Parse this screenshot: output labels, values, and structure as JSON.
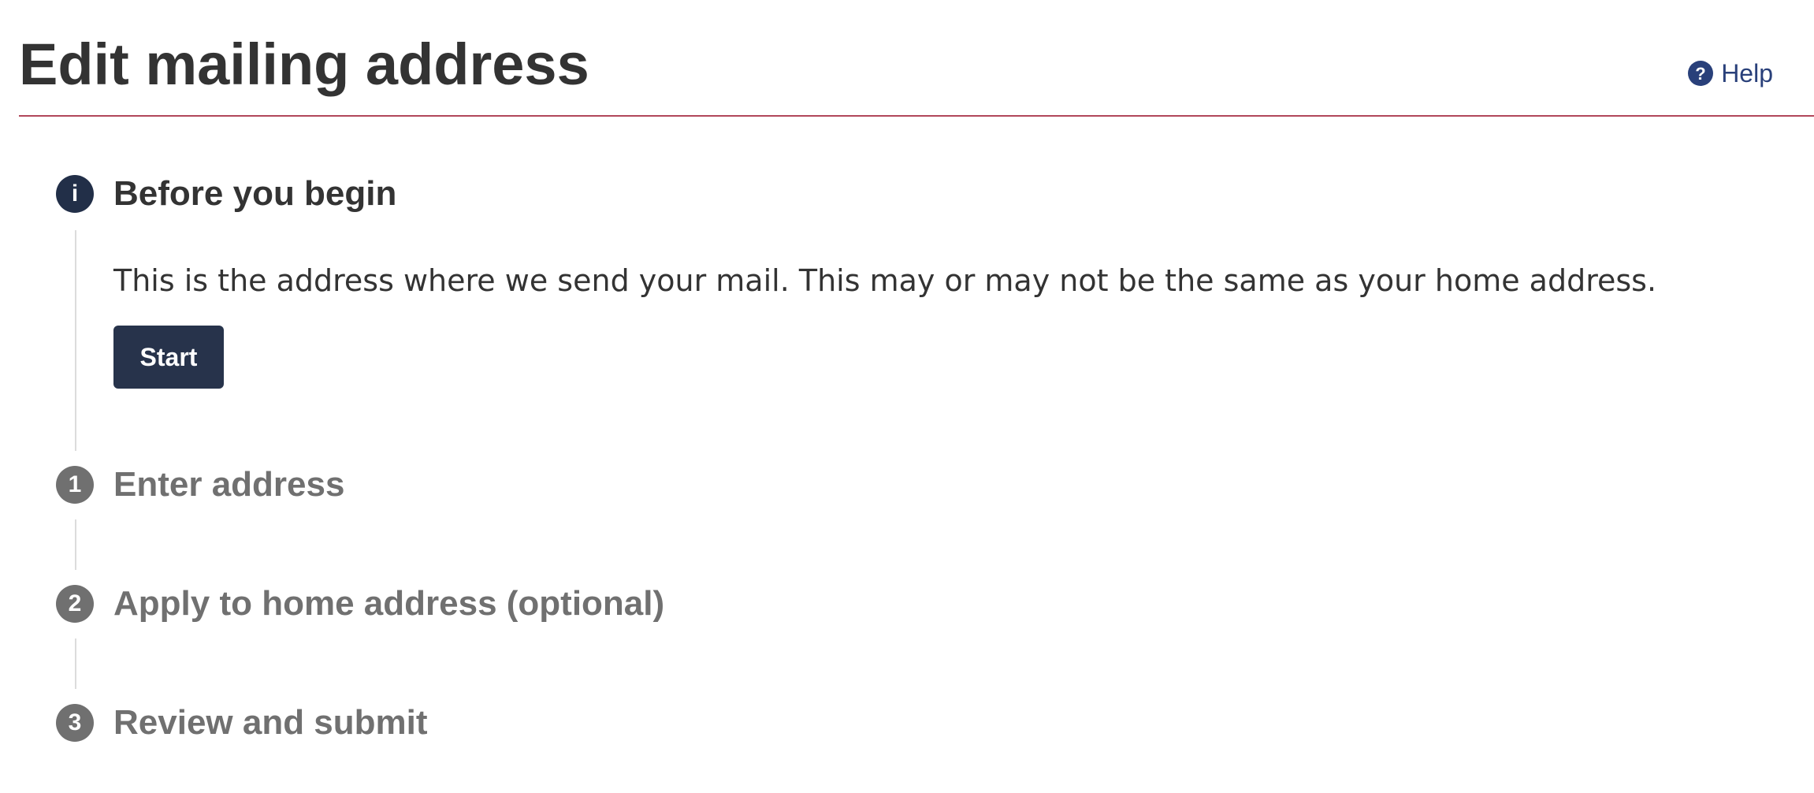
{
  "header": {
    "title": "Edit mailing address",
    "help_label": "Help",
    "help_icon": "question-circle-icon"
  },
  "colors": {
    "text": "#333333",
    "accent_rule": "#b1475a",
    "link": "#29407a",
    "active_step": "#222f48",
    "inactive_step": "#707070",
    "button_bg": "#27334b"
  },
  "steps": [
    {
      "marker": "i",
      "title": "Before you begin",
      "state": "active",
      "description": "This is the address where we send your mail. This may or may not be the same as your home address.",
      "button_label": "Start"
    },
    {
      "marker": "1",
      "title": "Enter address",
      "state": "inactive"
    },
    {
      "marker": "2",
      "title": "Apply to home address (optional)",
      "state": "inactive"
    },
    {
      "marker": "3",
      "title": "Review and submit",
      "state": "inactive"
    }
  ]
}
